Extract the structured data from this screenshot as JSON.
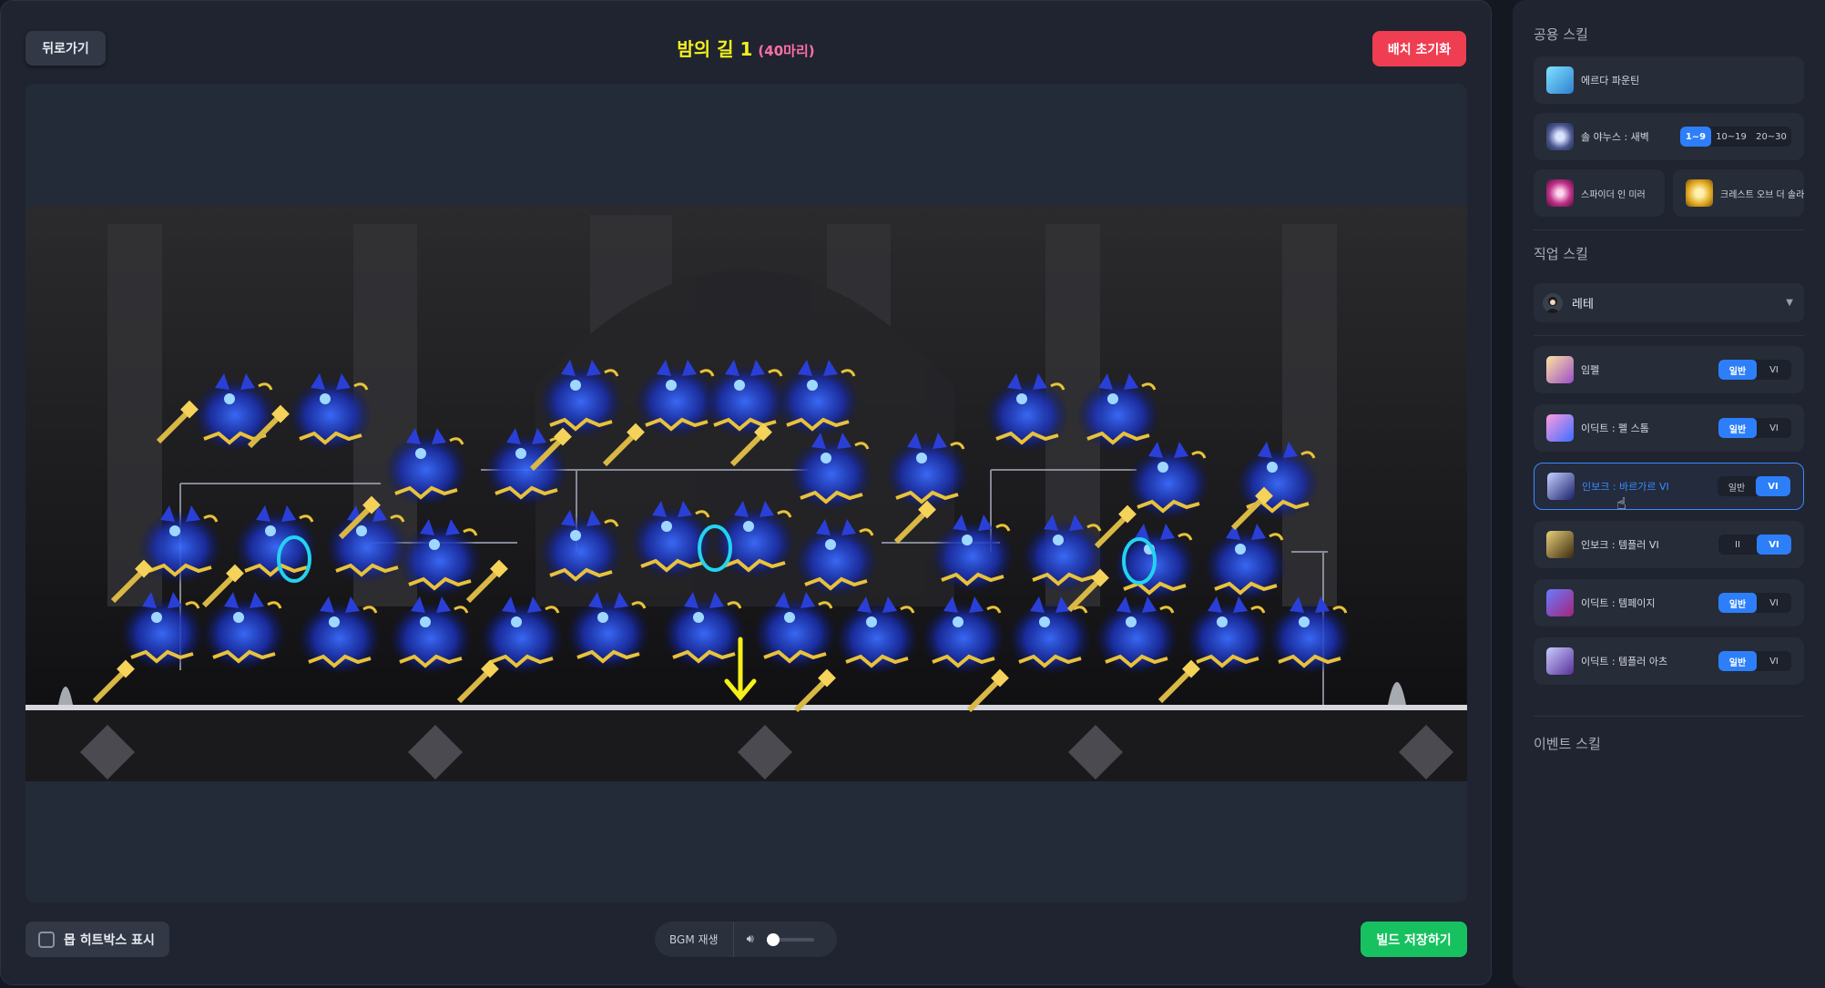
{
  "header": {
    "back_label": "뒤로가기",
    "title": "밤의 길 1",
    "count": "(40마리)",
    "reset_label": "배치 초기화"
  },
  "footer": {
    "hitbox_label": "몹 히트박스 표시",
    "bgm_label": "BGM 재생",
    "volume": 0,
    "save_label": "빌드 저장하기"
  },
  "sidebar": {
    "common_title": "공용 스킬",
    "common_skills": [
      {
        "label": "에르다 파운틴"
      },
      {
        "label": "솔 야누스 : 새벽",
        "tags": [
          "1~9",
          "10~19",
          "20~30"
        ],
        "selected": 0
      },
      {
        "label": "스파이더 인 미러"
      },
      {
        "label": "크레스트 오브 더 솔라"
      }
    ],
    "job_title": "직업 스킬",
    "job_select": "레테",
    "job_skills": [
      {
        "label": "임펠",
        "tags": [
          "일반",
          "VI"
        ],
        "selected": 0
      },
      {
        "label": "이딕트 : 펠 스톰",
        "tags": [
          "일반",
          "VI"
        ],
        "selected": 0
      },
      {
        "label": "인보크 : 바르가르 VI",
        "tags": [
          "일반",
          "VI"
        ],
        "selected": 1,
        "active": true
      },
      {
        "label": "인보크 : 템플러 VI",
        "tags": [
          "II",
          "VI"
        ],
        "selected": 1
      },
      {
        "label": "이딕트 : 템페이지",
        "tags": [
          "일반",
          "VI"
        ],
        "selected": 0
      },
      {
        "label": "이딕트 : 템플러 아츠",
        "tags": [
          "일반",
          "VI"
        ],
        "selected": 0
      }
    ],
    "event_title": "이벤트 스킬"
  },
  "colors": {
    "accent_blue": "#2d7ff9",
    "reset_red": "#ef3e52",
    "save_green": "#17c160",
    "title_yellow": "#f4f01c",
    "count_pink": "#ff6fa6"
  }
}
